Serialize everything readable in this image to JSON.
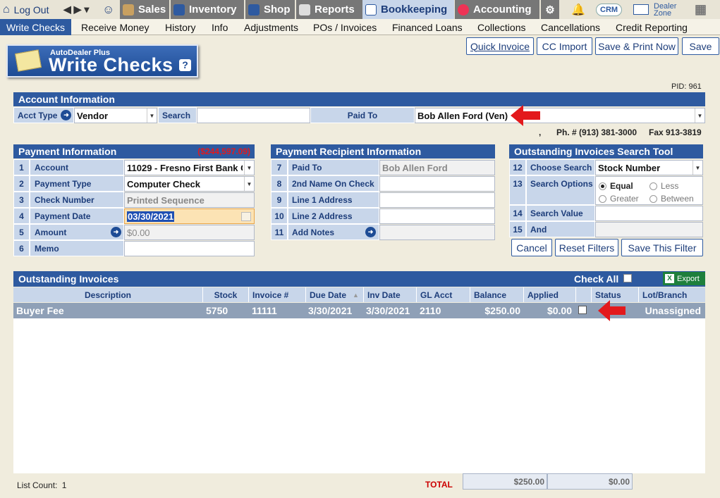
{
  "topbar": {
    "logout": "Log Out",
    "items": [
      "Sales",
      "Inventory",
      "Shop",
      "Reports",
      "Bookkeeping",
      "Accounting"
    ],
    "crm": "CRM",
    "dealer_zone": "Dealer Zone"
  },
  "nav": {
    "items": [
      "Write Checks",
      "Receive Money",
      "History",
      "Info",
      "Adjustments",
      "POs / Invoices",
      "Financed Loans",
      "Collections",
      "Cancellations",
      "Credit Reporting"
    ]
  },
  "toolbar": {
    "quick_invoice": "Quick Invoice",
    "cc_import": "CC Import",
    "save_print": "Save & Print Now",
    "save": "Save"
  },
  "logo": {
    "brand": "AutoDealer Plus",
    "title": "Write Checks",
    "help": "?"
  },
  "pid": "PID: 961",
  "account": {
    "title": "Account Information",
    "acct_type_label": "Acct Type",
    "acct_type": "Vendor",
    "search_label": "Search",
    "search_value": "",
    "paid_to_label": "Paid To",
    "paid_to": "Bob Allen Ford (Ven)",
    "comma": ",",
    "phone": "Ph. # (913) 381-3000",
    "fax": "Fax 913-3819"
  },
  "payment": {
    "title": "Payment Information",
    "balance": "($244,597.09)",
    "rows": [
      {
        "n": "1",
        "label": "Account",
        "value": "11029 - Fresno First Bank C"
      },
      {
        "n": "2",
        "label": "Payment Type",
        "value": "Computer Check"
      },
      {
        "n": "3",
        "label": "Check Number",
        "value": "Printed Sequence"
      },
      {
        "n": "4",
        "label": "Payment Date",
        "value": "03/30/2021"
      },
      {
        "n": "5",
        "label": "Amount",
        "value": "$0.00"
      },
      {
        "n": "6",
        "label": "Memo",
        "value": ""
      }
    ]
  },
  "recipient": {
    "title": "Payment Recipient Information",
    "rows": [
      {
        "n": "7",
        "label": "Paid To",
        "value": "Bob Allen Ford"
      },
      {
        "n": "8",
        "label": "2nd Name On Check",
        "value": ""
      },
      {
        "n": "9",
        "label": "Line 1 Address",
        "value": ""
      },
      {
        "n": "10",
        "label": "Line 2 Address",
        "value": ""
      },
      {
        "n": "11",
        "label": "Add Notes",
        "value": ""
      }
    ]
  },
  "search_tool": {
    "title": "Outstanding Invoices Search Tool",
    "rows": [
      {
        "n": "12",
        "label": "Choose Search",
        "value": "Stock Number"
      },
      {
        "n": "13",
        "label": "Search Options",
        "value": ""
      },
      {
        "n": "14",
        "label": "Search Value",
        "value": ""
      },
      {
        "n": "15",
        "label": "And",
        "value": ""
      }
    ],
    "options": [
      "Equal",
      "Less",
      "Greater",
      "Between"
    ],
    "selected_option": "Equal",
    "cancel": "Cancel",
    "reset": "Reset Filters",
    "save_filter": "Save This Filter"
  },
  "invoices": {
    "title": "Outstanding Invoices",
    "check_all": "Check All",
    "export": "Export",
    "columns": [
      "Description",
      "Stock",
      "Invoice #",
      "Due Date",
      "Inv Date",
      "GL Acct",
      "Balance",
      "Applied",
      "",
      "Status",
      "Lot/Branch"
    ],
    "rows": [
      {
        "description": "Buyer Fee",
        "stock": "5750",
        "invoice": "11111",
        "due": "3/30/2021",
        "inv": "3/30/2021",
        "gl": "2110",
        "balance": "$250.00",
        "applied": "$0.00",
        "status": "",
        "lot": "Unassigned"
      }
    ],
    "list_count_label": "List Count:",
    "list_count": "1",
    "total_label": "TOTAL",
    "total_balance": "$250.00",
    "total_applied": "$0.00"
  }
}
